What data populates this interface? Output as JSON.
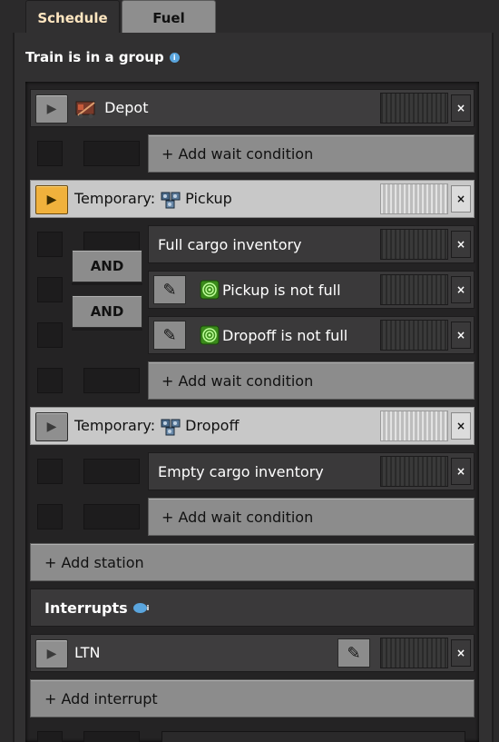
{
  "tabs": {
    "schedule": "Schedule",
    "fuel": "Fuel"
  },
  "heading": {
    "group_text": "Train is in a group"
  },
  "schedule": {
    "stations": [
      {
        "label": "Depot",
        "active": false,
        "add_wait": "+ Add wait condition"
      },
      {
        "prefix": "Temporary: ",
        "label": "Pickup",
        "active": true,
        "conditions": [
          {
            "text": "Full cargo inventory"
          },
          {
            "text": "Pickup is not full",
            "connector": "AND"
          },
          {
            "text": "Dropoff is not full",
            "connector": "AND"
          }
        ],
        "add_wait": "+ Add wait condition"
      },
      {
        "prefix": "Temporary: ",
        "label": "Dropoff",
        "active": false,
        "conditions": [
          {
            "text": "Empty cargo inventory"
          }
        ],
        "add_wait": "+ Add wait condition"
      }
    ],
    "add_station": "+ Add station"
  },
  "interrupts": {
    "title": "Interrupts",
    "items": [
      {
        "label": "LTN"
      }
    ],
    "add_interrupt": "+ Add interrupt"
  },
  "icons": {
    "close": "×",
    "play": "▶",
    "pencil": "✎"
  },
  "colors": {
    "active_play": "#f0b13c",
    "tab_active_text": "#ffe6c0",
    "info": "#5aa5dd",
    "signal_green": "#4bd12a"
  }
}
